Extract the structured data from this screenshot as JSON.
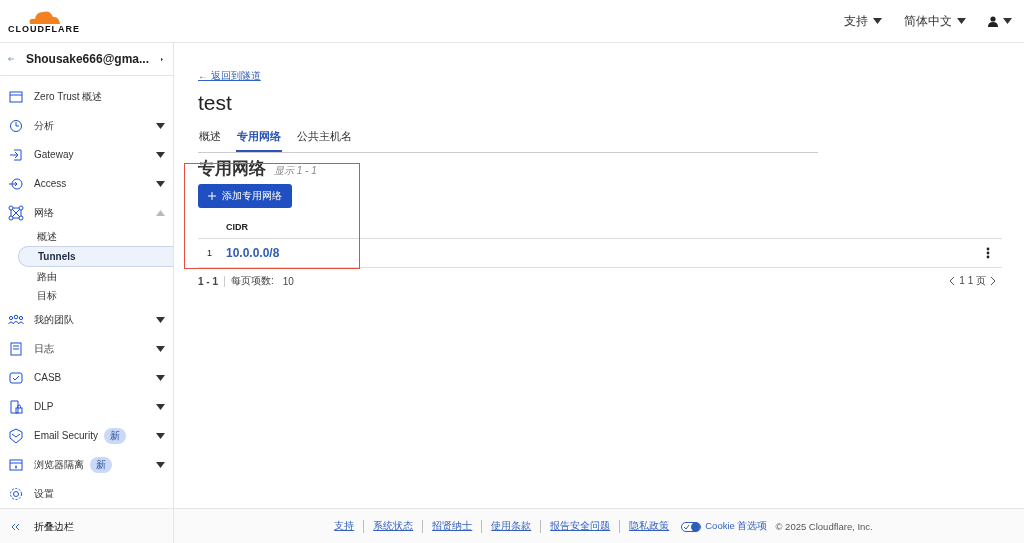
{
  "header": {
    "logo": "CLOUDFLARE",
    "menus": [
      {
        "label": "支持"
      },
      {
        "label": "简体中文"
      }
    ]
  },
  "sidebar": {
    "account": "Shousake666@gma...",
    "items": [
      {
        "label": "Zero Trust 概述"
      },
      {
        "label": "分析",
        "expanded": false
      },
      {
        "label": "Gateway",
        "expanded": false
      },
      {
        "label": "Access",
        "expanded": false
      },
      {
        "label": "网络",
        "expanded": true,
        "children": [
          {
            "label": "概述",
            "selected": false
          },
          {
            "label": "Tunnels",
            "selected": true
          },
          {
            "label": "路由",
            "selected": false
          },
          {
            "label": "目标",
            "selected": false
          }
        ]
      },
      {
        "label": "我的团队",
        "expanded": false
      },
      {
        "label": "日志",
        "expanded": false
      },
      {
        "label": "CASB",
        "expanded": false
      },
      {
        "label": "DLP",
        "expanded": false
      },
      {
        "label": "Email Security",
        "badge": "新",
        "expanded": false
      },
      {
        "label": "浏览器隔离",
        "badge": "新",
        "expanded": false
      },
      {
        "label": "设置"
      }
    ],
    "collapse": "折叠边栏"
  },
  "main": {
    "back_link": "← 返回到隧道",
    "title": "test",
    "tabs": [
      {
        "label": "概述",
        "selected": false
      },
      {
        "label": "专用网络",
        "selected": true
      },
      {
        "label": "公共主机名",
        "selected": false
      }
    ],
    "section_title": "专用网络",
    "section_count": "显示 1 - 1",
    "add_button": "添加专用网络",
    "table": {
      "columns": [
        "CIDR"
      ],
      "rows": [
        {
          "index": "1",
          "cidr": "10.0.0.0/8"
        }
      ]
    },
    "pagination": {
      "range": "1 - 1",
      "per_page_label": "每页项数:",
      "per_page": "10",
      "pages": "1 1 页"
    }
  },
  "footer": {
    "links": [
      "支持",
      "系统状态",
      "招贤纳士",
      "使用条款",
      "报告安全问题",
      "隐私政策"
    ],
    "cookie": "Cookie 首选项",
    "copyright": "© 2025 Cloudflare, Inc."
  }
}
